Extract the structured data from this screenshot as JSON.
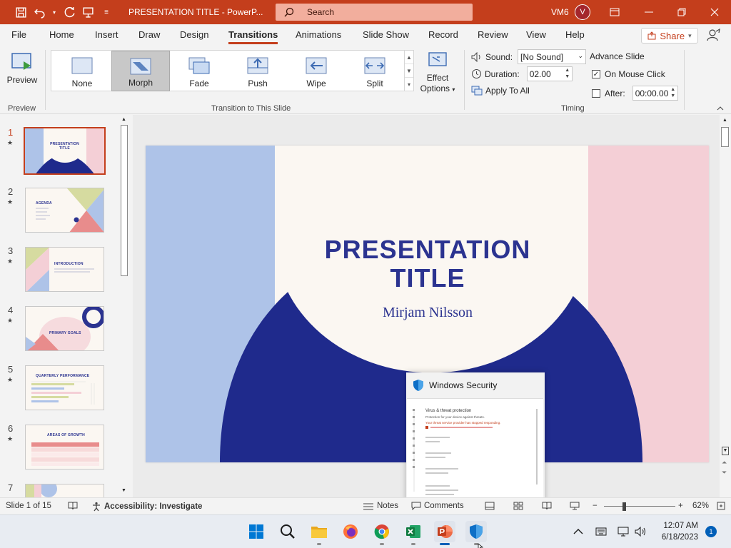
{
  "titlebar": {
    "doc_title": "PRESENTATION TITLE - PowerP...",
    "search_placeholder": "Search",
    "user_name": "VM6",
    "avatar_initial": "V"
  },
  "tabs": [
    "File",
    "Home",
    "Insert",
    "Draw",
    "Design",
    "Transitions",
    "Animations",
    "Slide Show",
    "Record",
    "Review",
    "View",
    "Help"
  ],
  "active_tab": "Transitions",
  "share_label": "Share",
  "ribbon": {
    "preview_label": "Preview",
    "preview_group": "Preview",
    "transitions": [
      "None",
      "Morph",
      "Fade",
      "Push",
      "Wipe",
      "Split"
    ],
    "selected_transition": "Morph",
    "effect_line1": "Effect",
    "effect_line2": "Options",
    "transition_group": "Transition to This Slide",
    "sound_label": "Sound:",
    "sound_value": "[No Sound]",
    "duration_label": "Duration:",
    "duration_value": "02.00",
    "apply_all": "Apply To All",
    "advance_label": "Advance Slide",
    "on_mouse_click": "On Mouse Click",
    "on_mouse_click_checked": true,
    "after_label": "After:",
    "after_value": "00:00.00",
    "after_checked": false,
    "timing_group": "Timing"
  },
  "thumbnails": [
    {
      "num": "1",
      "title": "PRESENTATION TITLE",
      "selected": true
    },
    {
      "num": "2",
      "title": "AGENDA",
      "selected": false
    },
    {
      "num": "3",
      "title": "INTRODUCTION",
      "selected": false
    },
    {
      "num": "4",
      "title": "PRIMARY GOALS",
      "selected": false
    },
    {
      "num": "5",
      "title": "QUARTERLY PERFORMANCE",
      "selected": false
    },
    {
      "num": "6",
      "title": "AREAS OF GROWTH",
      "selected": false
    },
    {
      "num": "7",
      "title": "",
      "selected": false
    }
  ],
  "slide": {
    "title_line1": "PRESENTATION",
    "title_line2": "TITLE",
    "subtitle": "Mirjam Nilsson",
    "colors": {
      "blue": "#aec3e8",
      "pink": "#f4cfd6",
      "navy": "#1f2a8c",
      "cream": "#fbf7f2"
    }
  },
  "popup": {
    "title": "Windows Security",
    "heading": "Virus & threat protection",
    "line1": "Protection for your device against threats.",
    "line2": "Your threat service provider has stopped responding."
  },
  "status": {
    "slide_info": "Slide 1 of 15",
    "accessibility": "Accessibility: Investigate",
    "notes": "Notes",
    "comments": "Comments",
    "zoom": "62%"
  },
  "taskbar": {
    "time": "12:07 AM",
    "date": "6/18/2023",
    "notifications": "1"
  },
  "colors": {
    "accent": "#c43e1c",
    "accent_light": "#f2ae9d"
  }
}
